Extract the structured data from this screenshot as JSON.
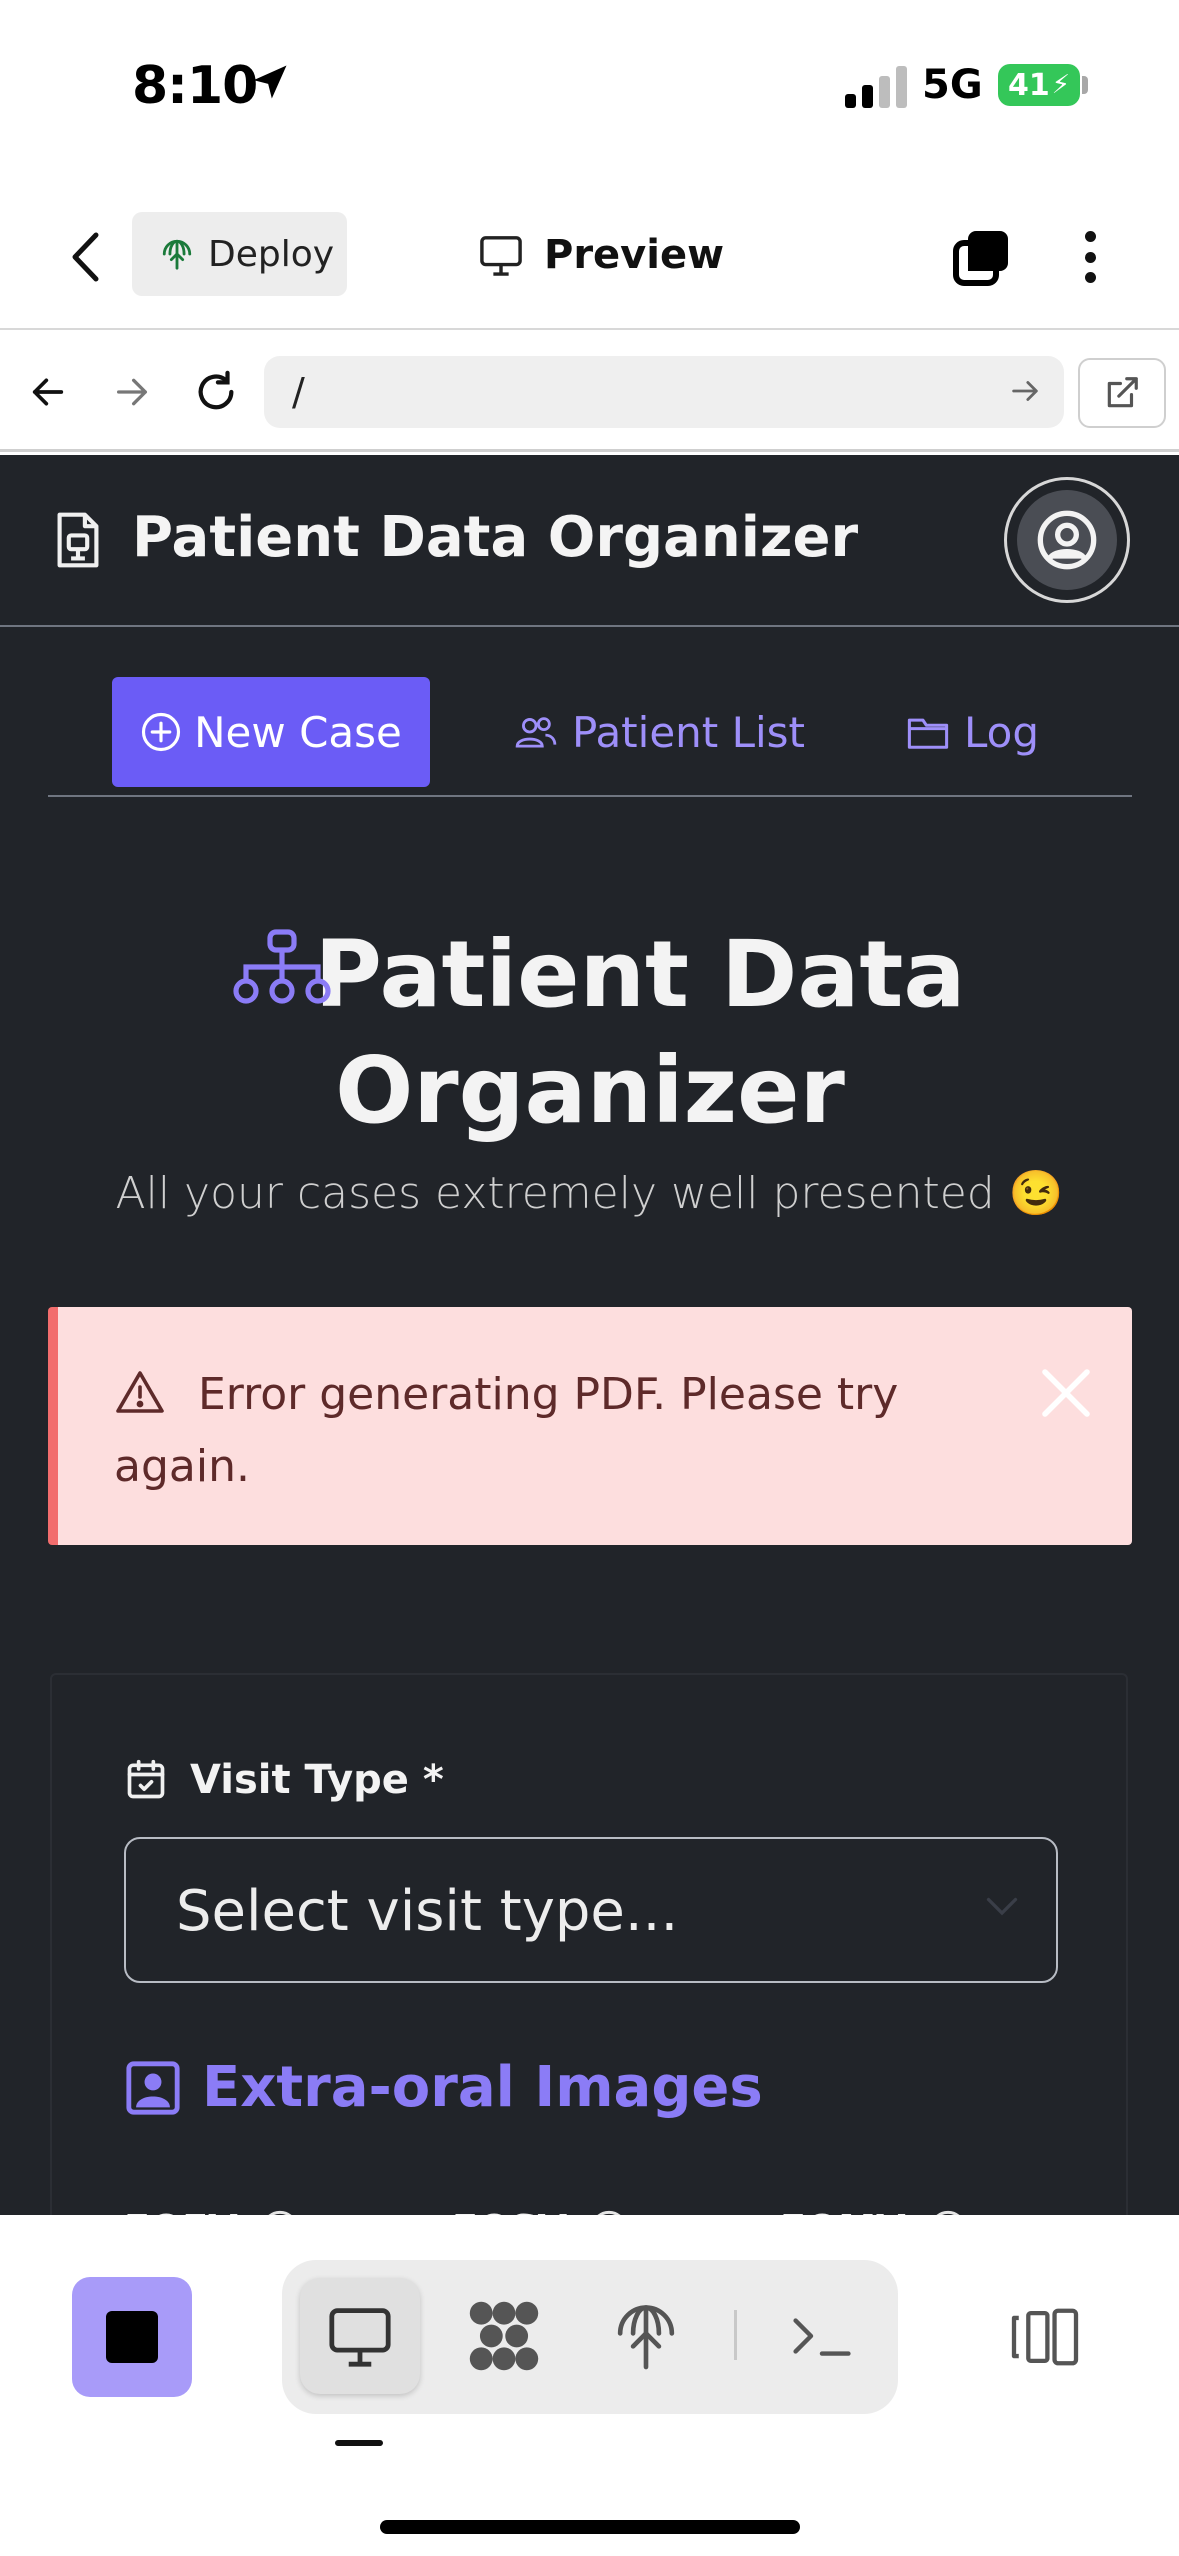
{
  "status_bar": {
    "time": "8:10",
    "network": "5G",
    "battery": "41"
  },
  "top_bar": {
    "deploy_label": "Deploy",
    "preview_label": "Preview"
  },
  "url_bar": {
    "url": "/"
  },
  "app": {
    "header_title": "Patient Data Organizer",
    "nav": {
      "new_case": "New Case",
      "patient_list": "Patient List",
      "log": "Log"
    },
    "hero": {
      "title_line1": "Patient Data",
      "title_line2": "Organizer",
      "subtitle": "All your cases extremely well presented 😉"
    },
    "alert": {
      "message": "Error generating PDF. Please try again."
    },
    "form": {
      "visit_type_label": "Visit Type *",
      "visit_type_placeholder": "Select visit type...",
      "extra_oral_title": "Extra-oral Images",
      "image_labels": [
        "EOFV",
        "EOSV",
        "EOMV"
      ]
    }
  },
  "colors": {
    "accent": "#6b5cf6",
    "app_background": "#212429",
    "alert_background": "#fddede",
    "alert_border": "#f26d6d",
    "stop_button": "#a89bf9",
    "battery": "#34c759"
  },
  "icons": [
    "location-arrow-icon",
    "signal-icon",
    "back-chevron-icon",
    "deploy-icon",
    "monitor-icon",
    "tabs-icon",
    "more-vertical-icon",
    "arrow-left-icon",
    "arrow-right-icon",
    "reload-icon",
    "external-link-icon",
    "file-logo-icon",
    "user-avatar-icon",
    "plus-circle-icon",
    "users-icon",
    "folder-icon",
    "sitemap-icon",
    "warning-icon",
    "close-icon",
    "calendar-check-icon",
    "chevron-down-icon",
    "portrait-icon",
    "info-icon",
    "stop-icon",
    "dots-grid-icon",
    "terminal-icon",
    "split-layout-icon"
  ]
}
